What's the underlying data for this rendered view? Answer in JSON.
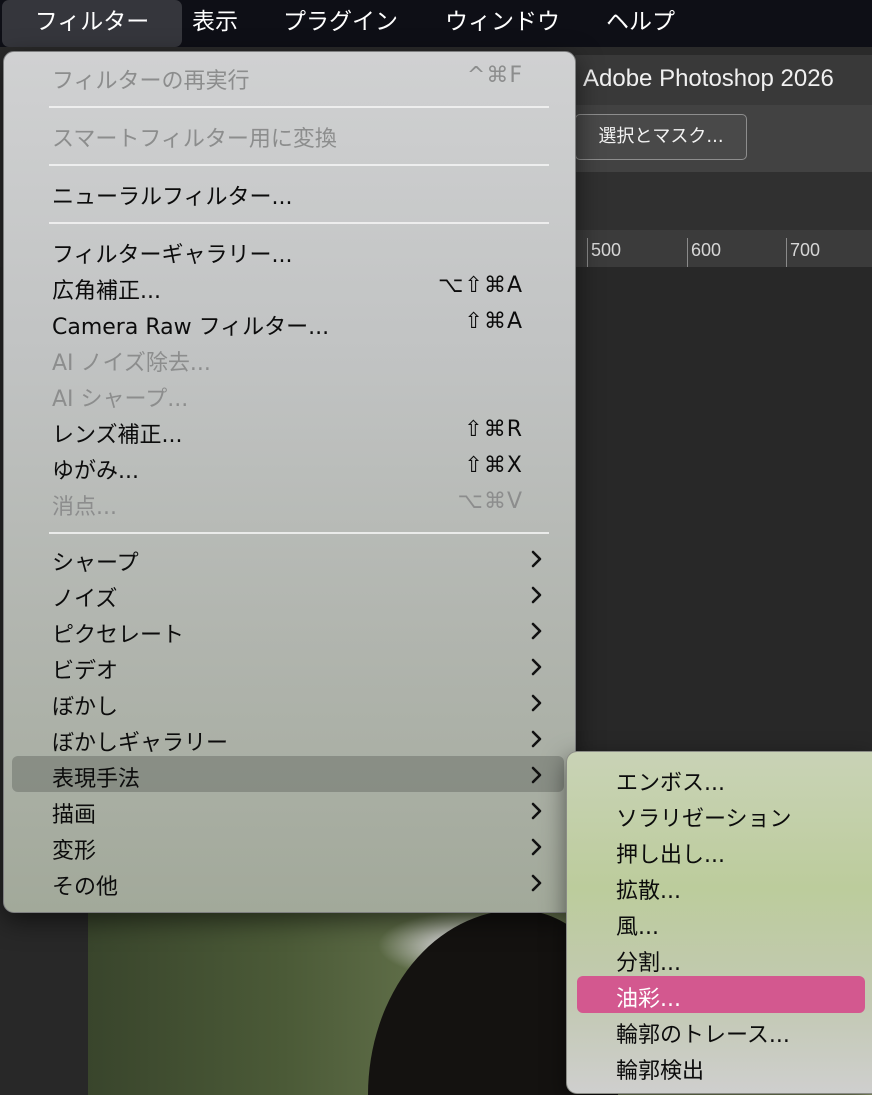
{
  "menubar": {
    "items": [
      {
        "label": "フィルター",
        "active": true
      },
      {
        "label": "表示"
      },
      {
        "label": "プラグイン"
      },
      {
        "label": "ウィンドウ"
      },
      {
        "label": "ヘルプ"
      }
    ]
  },
  "app": {
    "title": "Adobe Photoshop 2026",
    "select_mask_button": "選択とマスク...",
    "ruler": {
      "ticks": [
        "500",
        "600",
        "700"
      ]
    }
  },
  "filter_menu": {
    "items": [
      {
        "label": "フィルターの再実行",
        "shortcut": "^⌘F",
        "disabled": true
      },
      {
        "label": "スマートフィルター用に変換",
        "disabled": true
      },
      {
        "label": "ニューラルフィルター..."
      },
      {
        "label": "フィルターギャラリー..."
      },
      {
        "label": "広角補正...",
        "shortcut": "⌥⇧⌘A"
      },
      {
        "label": "Camera Raw フィルター...",
        "shortcut": "⇧⌘A"
      },
      {
        "label": "AI ノイズ除去...",
        "disabled": true
      },
      {
        "label": "AI シャープ...",
        "disabled": true
      },
      {
        "label": "レンズ補正...",
        "shortcut": "⇧⌘R"
      },
      {
        "label": "ゆがみ...",
        "shortcut": "⇧⌘X"
      },
      {
        "label": "消点...",
        "shortcut": "⌥⌘V",
        "disabled": true
      },
      {
        "label": "シャープ",
        "submenu": true
      },
      {
        "label": "ノイズ",
        "submenu": true
      },
      {
        "label": "ピクセレート",
        "submenu": true
      },
      {
        "label": "ビデオ",
        "submenu": true
      },
      {
        "label": "ぼかし",
        "submenu": true
      },
      {
        "label": "ぼかしギャラリー",
        "submenu": true
      },
      {
        "label": "表現手法",
        "submenu": true,
        "highlighted": true
      },
      {
        "label": "描画",
        "submenu": true
      },
      {
        "label": "変形",
        "submenu": true
      },
      {
        "label": "その他",
        "submenu": true
      }
    ]
  },
  "stylize_submenu": {
    "items": [
      {
        "label": "エンボス..."
      },
      {
        "label": "ソラリゼーション"
      },
      {
        "label": "押し出し..."
      },
      {
        "label": "拡散..."
      },
      {
        "label": "風..."
      },
      {
        "label": "分割..."
      },
      {
        "label": "油彩...",
        "selected": true
      },
      {
        "label": "輪郭のトレース..."
      },
      {
        "label": "輪郭検出"
      }
    ]
  },
  "colors": {
    "menubar_bg": "#0e0f16",
    "selection": "#d3588f",
    "highlight": "#6e726c"
  }
}
